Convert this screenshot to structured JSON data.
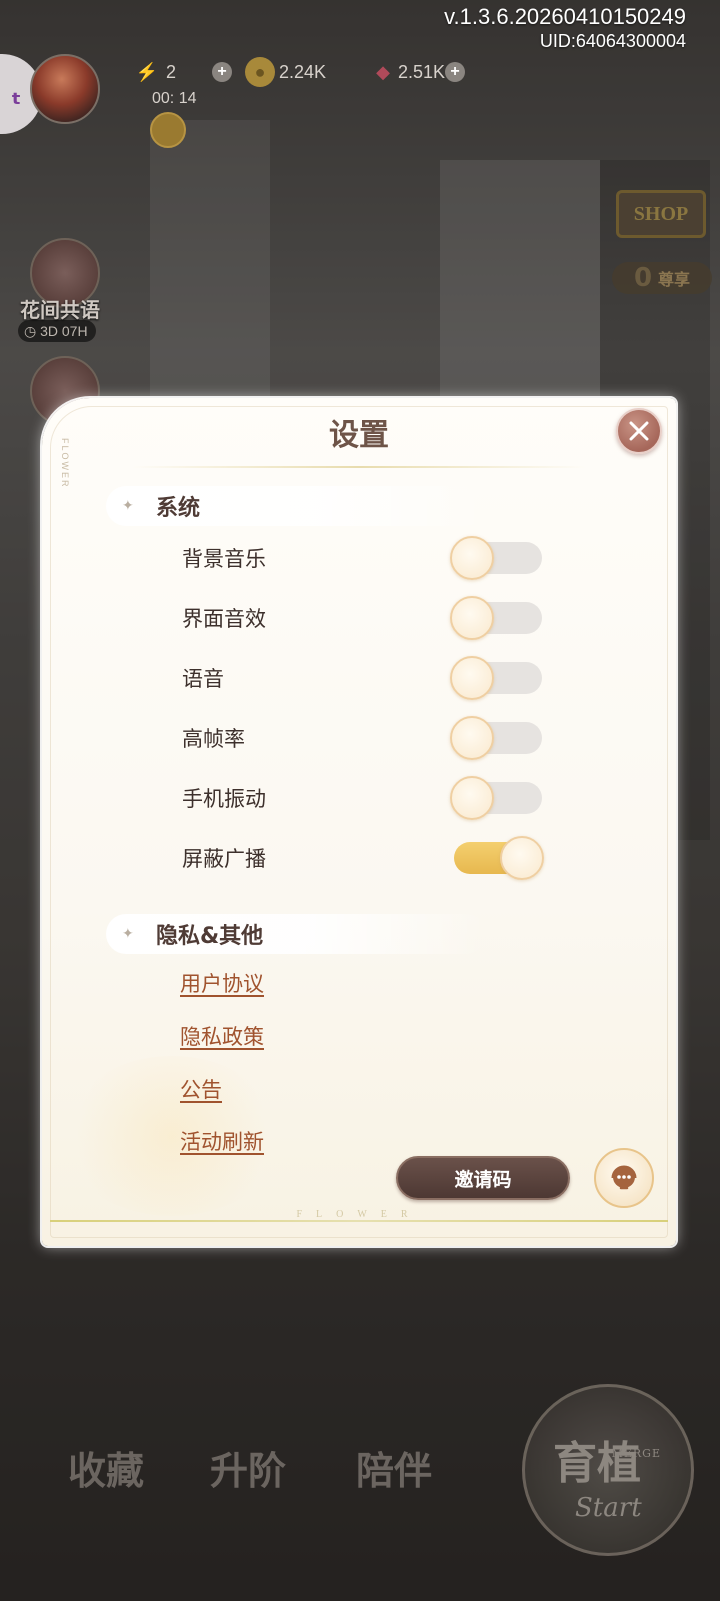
{
  "header": {
    "version": "v.1.3.6.20260410150249",
    "uid": "UID:64064300004"
  },
  "resources": {
    "energy": "2",
    "energy_timer": "00: 14",
    "gold": "2.24K",
    "gems": "2.51K"
  },
  "side_events": [
    {
      "label": "花间共语",
      "timer": "3D 07H"
    }
  ],
  "shop": {
    "sign": "SHOP",
    "vip_count": "0",
    "vip_label": "尊享"
  },
  "dialog": {
    "title": "设置",
    "flower_mark": "FLOWER",
    "system_section": "系统",
    "settings": [
      {
        "label": "背景音乐",
        "on": false
      },
      {
        "label": "界面音效",
        "on": false
      },
      {
        "label": "语音",
        "on": false
      },
      {
        "label": "高帧率",
        "on": false
      },
      {
        "label": "手机振动",
        "on": false
      },
      {
        "label": "屏蔽广播",
        "on": true
      }
    ],
    "privacy_section": "隐私&其他",
    "links": [
      "用户协议",
      "隐私政策",
      "公告",
      "活动刷新"
    ],
    "invite_label": "邀请码",
    "footer": "FLOWER"
  },
  "bottom_nav": [
    "收藏",
    "升阶",
    "陪伴"
  ],
  "start": {
    "big": "育植",
    "merge": "MERGE",
    "script": "Start"
  },
  "colors": {
    "toggle_on": "#e7b84f",
    "toggle_off": "#e6e3e0",
    "link": "#a0532e",
    "title": "#6e5448",
    "close": "#a6675a"
  }
}
